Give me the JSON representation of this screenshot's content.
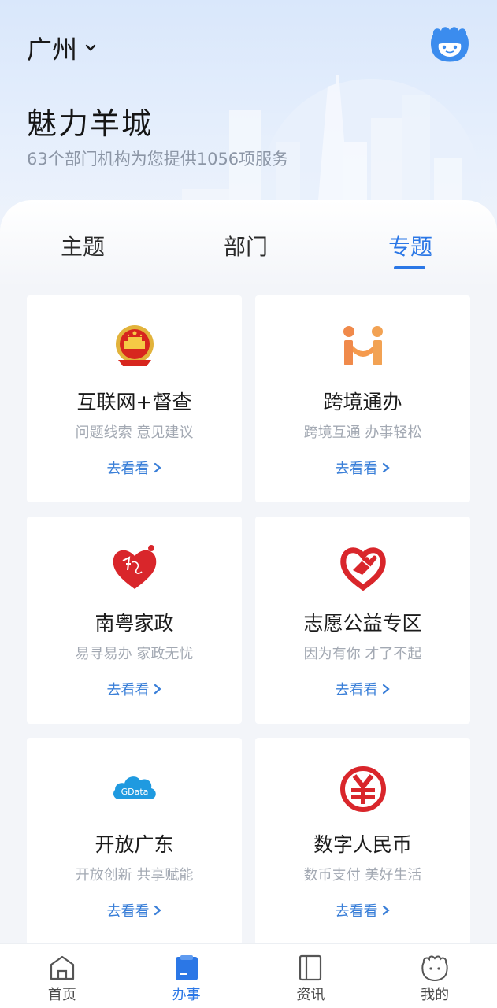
{
  "header": {
    "city": "广州",
    "title": "魅力羊城",
    "subtitle": "63个部门机构为您提供1056项服务"
  },
  "tabs": [
    {
      "label": "主题",
      "active": false
    },
    {
      "label": "部门",
      "active": false
    },
    {
      "label": "专题",
      "active": true
    }
  ],
  "cards": [
    {
      "title": "互联网+督查",
      "subtitle": "问题线索 意见建议",
      "action": "去看看",
      "icon": "national-emblem-icon"
    },
    {
      "title": "跨境通办",
      "subtitle": "跨境互通 办事轻松",
      "action": "去看看",
      "icon": "cross-border-icon"
    },
    {
      "title": "南粤家政",
      "subtitle": "易寻易办 家政无忧",
      "action": "去看看",
      "icon": "heart-housekeeping-icon"
    },
    {
      "title": "志愿公益专区",
      "subtitle": "因为有你 才了不起",
      "action": "去看看",
      "icon": "volunteer-heart-hand-icon"
    },
    {
      "title": "开放广东",
      "subtitle": "开放创新 共享赋能",
      "action": "去看看",
      "icon": "gdata-cloud-icon",
      "icon_text": "GData"
    },
    {
      "title": "数字人民币",
      "subtitle": "数币支付 美好生活",
      "action": "去看看",
      "icon": "digital-rmb-icon"
    }
  ],
  "bottom_nav": [
    {
      "label": "首页",
      "icon": "home-icon",
      "active": false
    },
    {
      "label": "办事",
      "icon": "clipboard-icon",
      "active": true
    },
    {
      "label": "资讯",
      "icon": "news-book-icon",
      "active": false
    },
    {
      "label": "我的",
      "icon": "mascot-face-icon",
      "active": false
    }
  ],
  "colors": {
    "accent": "#2b77e6",
    "link": "#3a7fd8",
    "emblem_red": "#d7261e",
    "cross_border_orange": "#f08a4b",
    "gdata_blue": "#1f9ae0"
  }
}
